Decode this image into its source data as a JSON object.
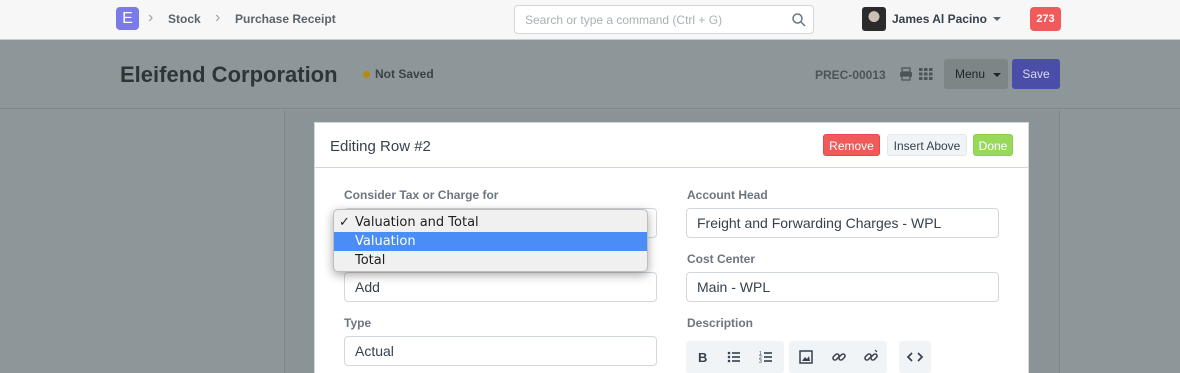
{
  "navbar": {
    "logo_letter": "E",
    "breadcrumbs": [
      "Stock",
      "Purchase Receipt"
    ],
    "search_placeholder": "Search or type a command (Ctrl + G)",
    "user_name": "James Al Pacino",
    "notification_count": "273"
  },
  "page_head": {
    "title": "Eleifend Corporation",
    "status": "Not Saved",
    "doc_name": "PREC-00013",
    "menu_label": "Menu",
    "save_label": "Save"
  },
  "panel": {
    "title": "Editing Row #2",
    "remove_label": "Remove",
    "insert_above_label": "Insert Above",
    "done_label": "Done",
    "fields": {
      "consider_tax_label": "Consider Tax or Charge for",
      "consider_tax_value": "Valuation and Total",
      "add_deduct_value": "Add",
      "type_label": "Type",
      "type_value": "Actual",
      "account_head_label": "Account Head",
      "account_head_value": "Freight and Forwarding Charges - WPL",
      "cost_center_label": "Cost Center",
      "cost_center_value": "Main - WPL",
      "description_label": "Description"
    }
  },
  "dropdown": {
    "options": [
      {
        "label": "Valuation and Total",
        "check": "✓"
      },
      {
        "label": "Valuation",
        "check": ""
      },
      {
        "label": "Total",
        "check": ""
      }
    ]
  },
  "colors": {
    "brand": "#7a7be8",
    "danger": "#f05a5a",
    "success": "#98d85b",
    "highlight": "#4a8df6"
  }
}
